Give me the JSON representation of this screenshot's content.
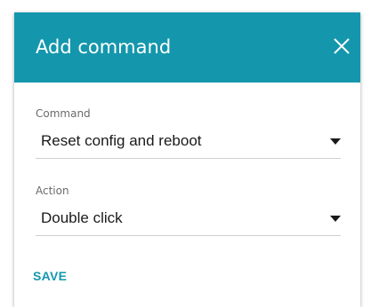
{
  "dialog": {
    "title": "Add command",
    "close_icon": "close-icon",
    "header_color": "#1497ad"
  },
  "fields": {
    "command": {
      "label": "Command",
      "value": "Reset config and reboot",
      "icon": "chevron-down-icon"
    },
    "action": {
      "label": "Action",
      "value": "Double click",
      "icon": "chevron-down-icon"
    }
  },
  "footer": {
    "save_label": "SAVE",
    "accent_color": "#1497ad"
  }
}
